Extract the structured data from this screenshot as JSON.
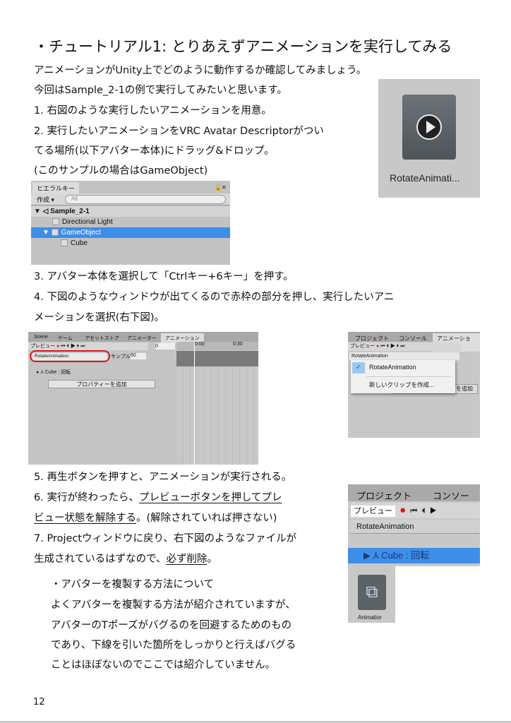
{
  "heading": "・チュートリアル1: とりあえずアニメーションを実行してみる",
  "intro": [
    "アニメーションがUnity上でどのように動作するか確認してみましょう。",
    "今回はSample_2-1の例で実行してみたいと思います。",
    "1. 右図のような実行したいアニメーションを用意。",
    "2. 実行したいアニメーションをVRC Avatar Descriptorがつい",
    "てる場所(以下アバター本体)にドラッグ&ドロップ。",
    "(このサンプルの場合はGameObject)"
  ],
  "anim_asset": {
    "label": "RotateAnimati..."
  },
  "hierarchy": {
    "tab": "ヒエラルキー",
    "create": "作成 ▾",
    "search_placeholder": "All",
    "scene": "Sample_2-1",
    "items": [
      "Directional Light",
      "GameObject",
      "Cube"
    ]
  },
  "steps34": [
    "3. アバター本体を選択して「Ctrlキー+6キー」を押す。",
    "4. 下図のようなウィンドウが出てくるので赤枠の部分を押し、実行したいアニ",
    "メーションを選択(右下図)。"
  ],
  "anim_window": {
    "tabs": [
      "Scene",
      "ゲーム",
      "アセットストア",
      "アニメーター",
      "アニメーション"
    ],
    "preview": "プレビュー",
    "frame": "0",
    "clip": "RotateAnimation",
    "sample_label": "サンプル",
    "sample": "60",
    "times": [
      "0:00",
      "0:30"
    ],
    "property": "Cube : 回転",
    "add_property": "プロパティーを追加"
  },
  "dropdown": {
    "tabs": [
      "プロジェクト",
      "コンソール",
      "アニメーション"
    ],
    "preview": "プレビュー",
    "clip": "RotateAnimation",
    "options": [
      "RotateAnimation",
      "新しいクリップを作成..."
    ],
    "behind": "を追加"
  },
  "steps567": {
    "l1": "5. 再生ボタンを押すと、アニメーションが実行される。",
    "l2a": "6. 実行が終わったら、",
    "l2b": "プレビューボタンを押してプレ",
    "l3a": "ビュー状態を解除する",
    "l3b": "。(解除されていれば押さない)",
    "l4": "7. Projectウィンドウに戻り、右下図のようなファイルが",
    "l5a": "生成されているはずなので、",
    "l5b": "必ず削除",
    "l5c": "。"
  },
  "project_ss": {
    "tabs": [
      "プロジェクト",
      "コンソール"
    ],
    "preview": "プレビュー",
    "clip": "RotateAnimation",
    "property": "Cube : 回転",
    "animator": "Animatior"
  },
  "note": [
    "・アバターを複製する方法について",
    "よくアバターを複製する方法が紹介されていますが、",
    "アバターのTポーズがバグるのを回避するためのもの",
    "であり、下線を引いた箇所をしっかりと行えばバグる",
    "ことはほぼないのでここでは紹介していません。"
  ],
  "page_number": "12",
  "colors": {
    "select": "#3d8ee9",
    "record": "#d9181e"
  }
}
